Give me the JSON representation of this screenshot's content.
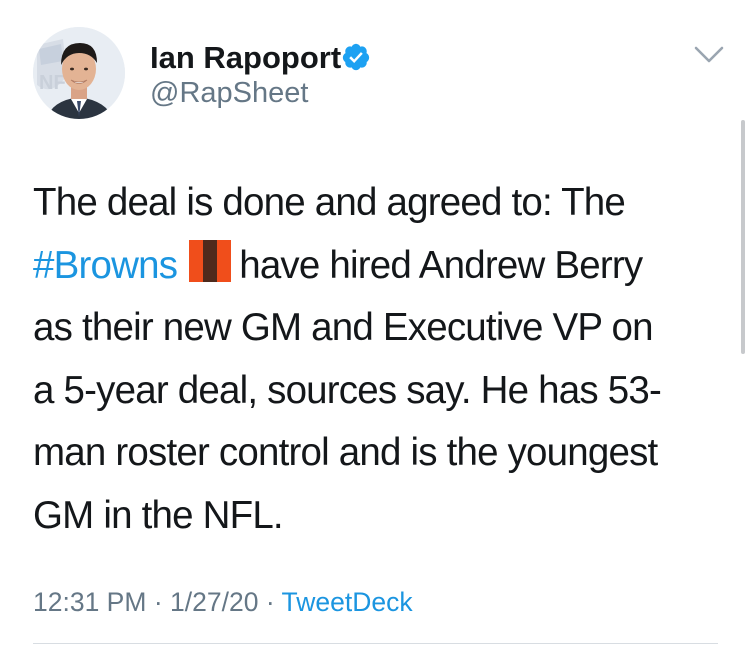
{
  "author": {
    "display_name": "Ian Rapoport",
    "handle": "@RapSheet",
    "avatar": "profile-photo",
    "verified_icon": "verified-badge-icon"
  },
  "tweet": {
    "lines": [
      "The deal is done and agreed to: The",
      {
        "hashtag": "#Browns",
        "emoji": "orange-brown-flag-emoji",
        "rest": "have hired Andrew Berry"
      },
      "as their new GM and Executive VP on",
      "a 5-year deal, sources say. He has 53-",
      "man roster control and is the youngest",
      "GM in the NFL."
    ]
  },
  "meta": {
    "time": "12:31 PM",
    "date": "1/27/20",
    "source": "TweetDeck",
    "separator": "·"
  },
  "colors": {
    "link": "#1b95e0",
    "secondary_text": "#657786",
    "primary_text": "#14171a",
    "verified": "#1da1f2",
    "browns_orange": "#f04e1b",
    "browns_brown": "#4e2a1c"
  }
}
